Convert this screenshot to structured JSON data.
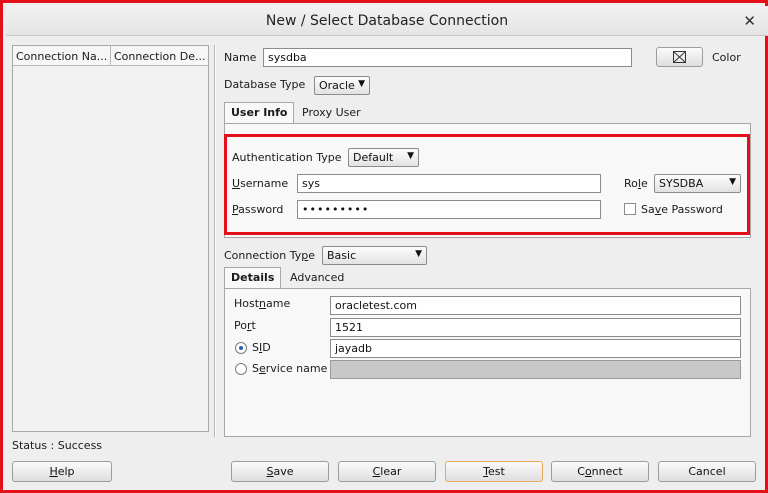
{
  "window": {
    "title": "New / Select Database Connection",
    "close_icon": "close-icon"
  },
  "connection_list": {
    "columns": [
      "Connection Na...",
      "Connection De..."
    ]
  },
  "status": {
    "text": "Status : Success"
  },
  "form": {
    "name_label": "Name",
    "name_value": "sysdba",
    "color_label": "Color",
    "db_type_label": "Database Type",
    "db_type_value": "Oracle",
    "tabs": [
      "User Info",
      "Proxy User"
    ],
    "auth_type_label": "Authentication Type",
    "auth_type_value": "Default",
    "username_label_u": "U",
    "username_label_rest": "sername",
    "username_value": "sys",
    "role_label_pre": "Ro",
    "role_label_u": "l",
    "role_label_post": "e",
    "role_value": "SYSDBA",
    "password_label_u": "P",
    "password_label_rest": "assword",
    "password_value": "•••••••••",
    "save_password_pre": "Sa",
    "save_password_u": "v",
    "save_password_post": "e Password",
    "conn_type_label_pre": "Connection Ty",
    "conn_type_label_u": "p",
    "conn_type_label_post": "e",
    "conn_type_value": "Basic",
    "details_tabs": [
      "Details",
      "Advanced"
    ],
    "hostname_label_pre": "Host",
    "hostname_label_u": "n",
    "hostname_label_post": "ame",
    "hostname_value": "oracletest.com",
    "port_label_pre": "Po",
    "port_label_u": "r",
    "port_label_post": "t",
    "port_value": "1521",
    "sid_label_pre": "S",
    "sid_label_u": "I",
    "sid_label_post": "D",
    "sid_value": "jayadb",
    "service_label_pre": "S",
    "service_label_u": "e",
    "service_label_post": "rvice name",
    "service_value": ""
  },
  "buttons": {
    "help": {
      "u": "H",
      "rest": "elp"
    },
    "save": {
      "u": "S",
      "rest": "ave"
    },
    "clear": {
      "u": "C",
      "rest": "lear"
    },
    "test": {
      "u": "T",
      "rest": "est"
    },
    "connect_pre": "C",
    "connect_u": "o",
    "connect_post": "nnect",
    "cancel": "Cancel"
  },
  "colors": {
    "highlight": "#e3101c",
    "frame": "#e3101c"
  }
}
